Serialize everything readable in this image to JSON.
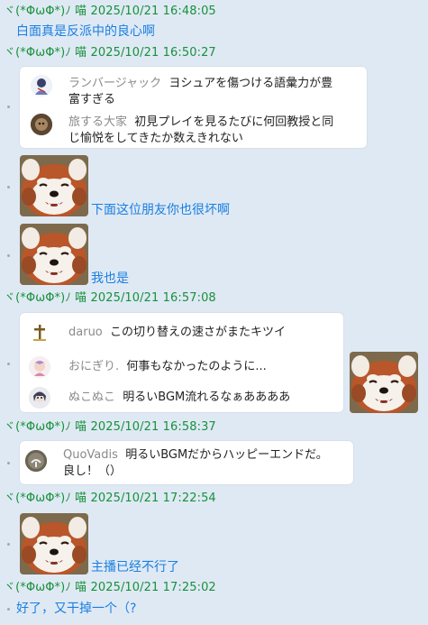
{
  "messages": [
    {
      "header": "ヾ(*ΦωΦ*)ﾉ 喵 2025/10/21 16:48:05",
      "text": "白面真是反派中的良心啊"
    },
    {
      "header": "ヾ(*ΦωΦ*)ﾉ 喵 2025/10/21 16:50:27"
    },
    {
      "text": "下面这位朋友你也很坏啊"
    },
    {
      "text": "我也是"
    },
    {
      "header": "ヾ(*ΦωΦ*)ﾉ 喵 2025/10/21 16:57:08"
    },
    {
      "header": "ヾ(*ΦωΦ*)ﾉ 喵 2025/10/21 16:58:37"
    },
    {
      "header": "ヾ(*ΦωΦ*)ﾉ 喵 2025/10/21 17:22:54",
      "text": "主播已经不行了"
    },
    {
      "header": "ヾ(*ΦωΦ*)ﾉ 喵 2025/10/21 17:25:02",
      "text": "好了，又干掉一个（?"
    }
  ],
  "card1": [
    {
      "name": "ランバージャック",
      "text_line1": "ヨシュアを傷つける語彙力が豊",
      "text_line2": "富すぎる"
    },
    {
      "name": "旅する大家",
      "text_line1": "初見プレイを見るたびに何回教授と同",
      "text_line2": "じ愉悦をしてきたか数えきれない"
    }
  ],
  "card2": [
    {
      "name": "daruo",
      "text": "この切り替えの速さがまたキツイ"
    },
    {
      "name": "おにぎり.",
      "text": "何事もなかったのように..."
    },
    {
      "name": "ぬこぬこ",
      "text": "明るいBGM流れるなぁああああ"
    }
  ],
  "card3": {
    "name": "QuoVadis",
    "text_line1": "明るいBGMだからハッピーエンドだ。",
    "text_line2": "良し！（）"
  },
  "colors": {
    "header": "#17913a",
    "message": "#1a7fe0",
    "background": "#dfe9f4"
  }
}
